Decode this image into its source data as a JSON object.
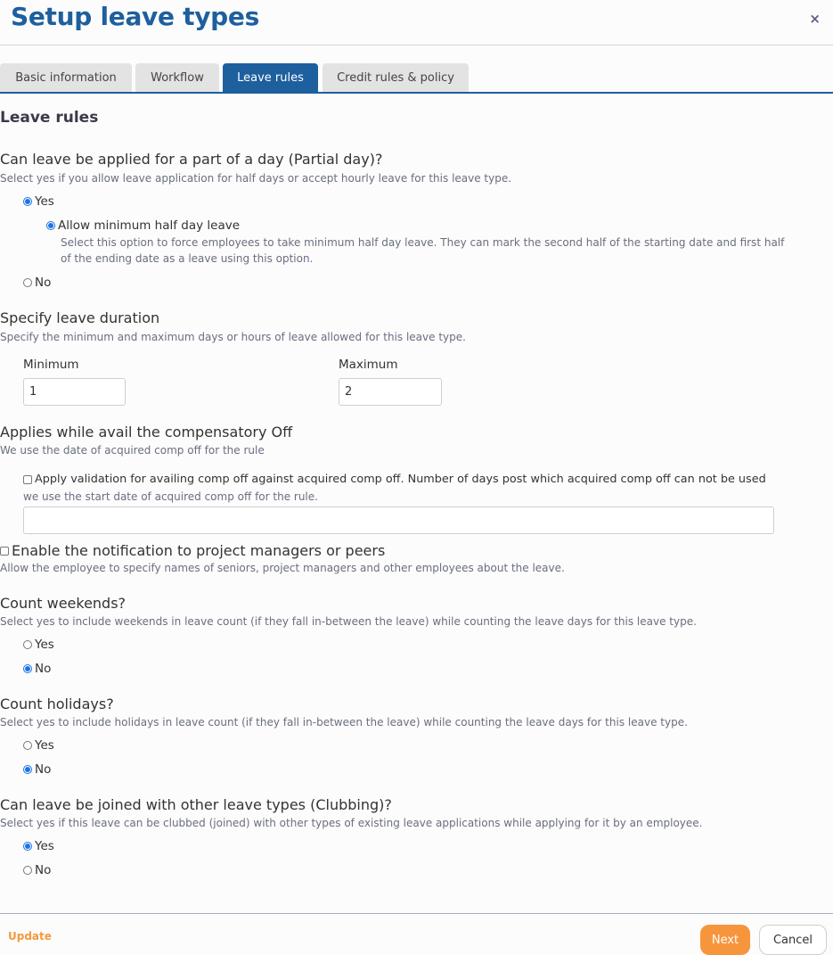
{
  "header": {
    "title": "Setup leave types",
    "close_icon": "×"
  },
  "tabs": [
    {
      "label": "Basic information",
      "active": false
    },
    {
      "label": "Workflow",
      "active": false
    },
    {
      "label": "Leave rules",
      "active": true
    },
    {
      "label": "Credit rules & policy",
      "active": false
    }
  ],
  "section_title": "Leave rules",
  "partial_day": {
    "question": "Can leave be applied for a part of a day (Partial day)?",
    "description": "Select yes if you allow leave application for half days or accept hourly leave for this leave type.",
    "yes_label": "Yes",
    "yes_selected": true,
    "sub_option_label": "Allow minimum half day leave",
    "sub_option_selected": true,
    "sub_option_desc_line1": "Select this option to force employees to take minimum half day leave. They can mark the second half of the starting date and first half",
    "sub_option_desc_line2": "of the ending date as a leave using this option.",
    "no_label": "No",
    "no_selected": false
  },
  "duration": {
    "question": "Specify leave duration",
    "description": "Specify the minimum and maximum days or hours of leave allowed for this leave type.",
    "minimum_label": "Minimum",
    "minimum_value": "1",
    "maximum_label": "Maximum",
    "maximum_value": "2"
  },
  "comp_off": {
    "question": "Applies while avail the compensatory Off",
    "description": "We use the date of acquired comp off for the rule",
    "checkbox_label": "Apply validation for availing comp off against acquired comp off. Number of days post which acquired comp off can not be used",
    "checked": false,
    "sub_description": "we use the start date of acquired comp off for the rule.",
    "days_value": ""
  },
  "notification": {
    "label": "Enable the notification to project managers or peers",
    "checked": false,
    "description": "Allow the employee to specify names of seniors, project managers and other employees about the leave."
  },
  "weekends": {
    "question": "Count weekends?",
    "description": "Select yes to include weekends in leave count (if they fall in-between the leave) while counting the leave days for this leave type.",
    "yes_label": "Yes",
    "no_label": "No",
    "selected": "No"
  },
  "holidays": {
    "question": "Count holidays?",
    "description": "Select yes to include holidays in leave count (if they fall in-between the leave) while counting the leave days for this leave type.",
    "yes_label": "Yes",
    "no_label": "No",
    "selected": "No"
  },
  "clubbing": {
    "question": "Can leave be joined with other leave types (Clubbing)?",
    "description": "Select yes if this leave can be clubbed (joined) with other types of existing leave applications while applying for it by an employee.",
    "yes_label": "Yes",
    "no_label": "No",
    "selected": "Yes"
  },
  "footer": {
    "update_label": "Update",
    "next_label": "Next",
    "cancel_label": "Cancel"
  },
  "colors": {
    "brand_blue": "#1e5f9e",
    "accent_orange": "#f7953c",
    "radio_blue": "#1a73e8"
  }
}
